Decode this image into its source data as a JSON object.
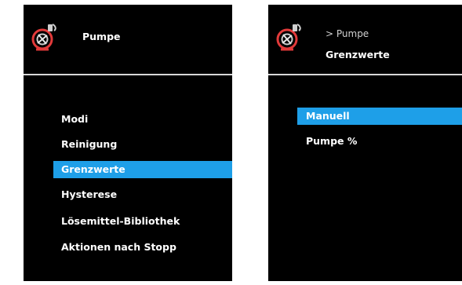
{
  "colors": {
    "background": "#000000",
    "selection": "#1e9fe8",
    "text": "#ffffff",
    "divider": "#d8d8d8"
  },
  "left_screen": {
    "header": {
      "icon": "pump-icon",
      "title": "Pumpe"
    },
    "menu": {
      "items": [
        {
          "label": "Modi",
          "selected": false
        },
        {
          "label": "Reinigung",
          "selected": false
        },
        {
          "label": "Grenzwerte",
          "selected": true
        },
        {
          "label": "Hysterese",
          "selected": false
        },
        {
          "label": "Lösemittel-Bibliothek",
          "selected": false
        },
        {
          "label": "Aktionen nach Stopp",
          "selected": false
        }
      ]
    }
  },
  "right_screen": {
    "header": {
      "icon": "pump-icon",
      "breadcrumb": "> Pumpe",
      "title": "Grenzwerte"
    },
    "menu": {
      "items": [
        {
          "label": "Manuell",
          "selected": true
        },
        {
          "label": "Pumpe %",
          "selected": false
        }
      ]
    }
  }
}
